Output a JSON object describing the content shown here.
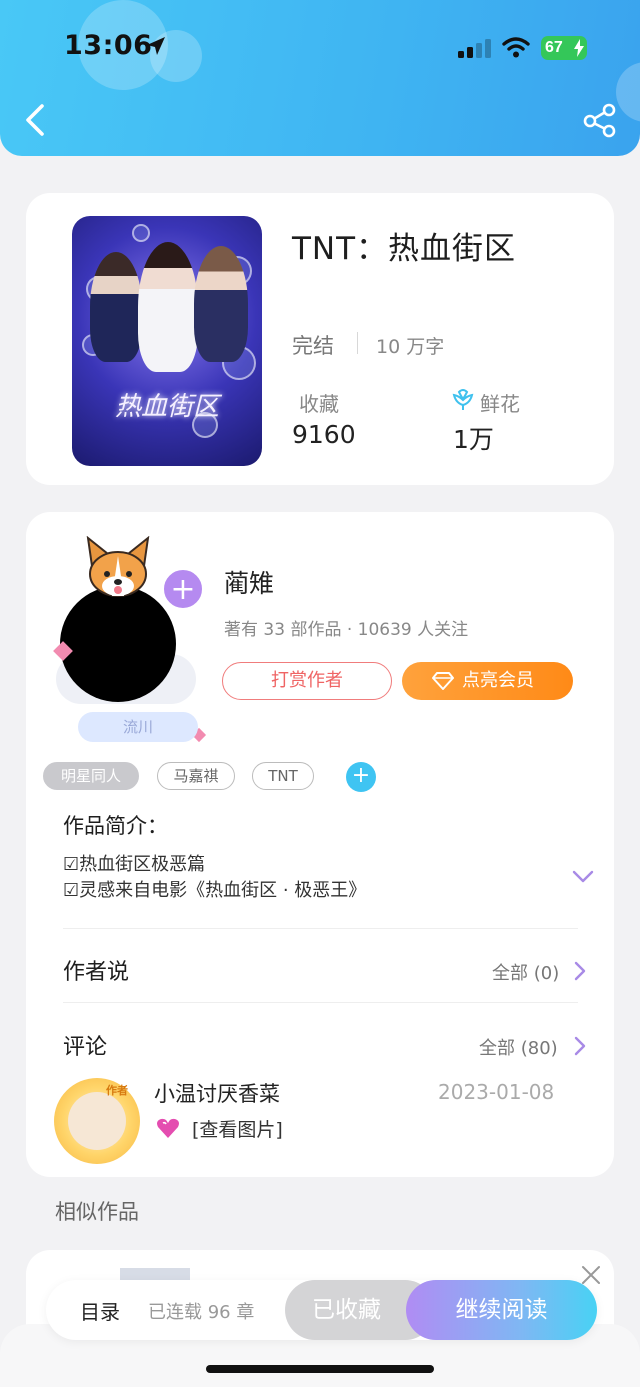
{
  "status_bar": {
    "time": "13:06",
    "battery": "67"
  },
  "book": {
    "title": "TNT：热血街区",
    "cover_title": "热血街区",
    "status": "完结",
    "word_count": "10 万字",
    "favorites_label": "收藏",
    "favorites_value": "9160",
    "flowers_label": "鲜花",
    "flowers_value": "1万"
  },
  "author": {
    "name": "蔺雉",
    "meta": "著有 33 部作品 · 10639 人关注",
    "tip_label": "打赏作者",
    "vip_label": "点亮会员",
    "fan_badge": "流川"
  },
  "tags": [
    "明星同人",
    "马嘉祺",
    "TNT"
  ],
  "intro": {
    "title": "作品简介：",
    "lines": [
      "☑热血街区极恶篇",
      "☑灵感来自电影《热血街区 · 极恶王》"
    ]
  },
  "author_says": {
    "title": "作者说",
    "more": "全部 (0)"
  },
  "comments": {
    "title": "评论",
    "more": "全部 (80)",
    "items": [
      {
        "badge": "作者",
        "user": "小温讨厌香菜",
        "date": "2023-01-08",
        "text": "[查看图片]"
      }
    ]
  },
  "similar": {
    "title": "相似作品"
  },
  "bottom_bar": {
    "toc": "目录",
    "serial": "已连载 96 章",
    "favorited": "已收藏",
    "continue": "继续阅读"
  }
}
